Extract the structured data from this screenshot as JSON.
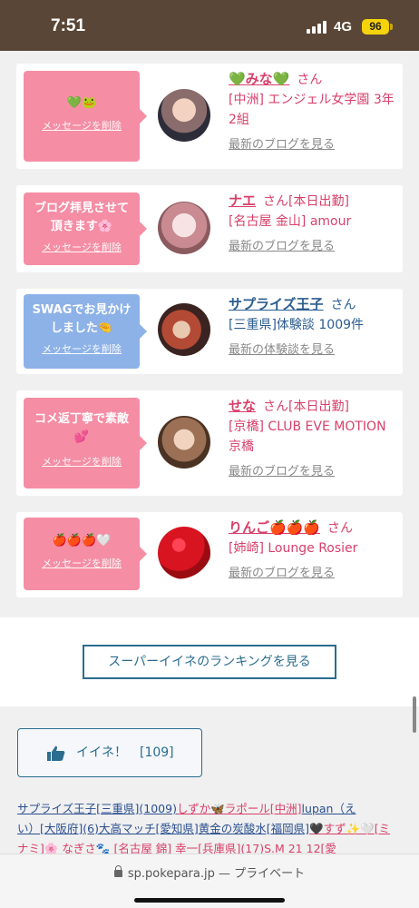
{
  "status_bar": {
    "time": "7:51",
    "network": "4G",
    "battery": "96"
  },
  "cards": [
    {
      "bubble_color": "pink",
      "bubble_text": "💚🐸",
      "delete_label": "メッセージを削除",
      "name": "💚みな💚",
      "san": "さん",
      "detail": "[中洲] エンジェル女学園 3年2組",
      "link": "最新のブログを見る"
    },
    {
      "bubble_color": "pink",
      "bubble_text": "ブログ拝見させて頂きます🌸",
      "delete_label": "メッセージを削除",
      "name": "ナエ",
      "san": "さん[本日出勤]",
      "detail": "[名古屋 金山] amour",
      "link": "最新のブログを見る"
    },
    {
      "bubble_color": "blue",
      "bubble_text": "SWAGでお見かけしました🤏",
      "delete_label": "メッセージを削除",
      "name": "サプライズ王子",
      "san": "さん",
      "detail": "[三重県]体験談 1009件",
      "link": "最新の体験談を見る"
    },
    {
      "bubble_color": "pink",
      "bubble_text": "コメ返丁寧で素敵💕",
      "delete_label": "メッセージを削除",
      "name": "せな",
      "san": "さん[本日出勤]",
      "detail": "[京橋] CLUB EVE MOTION 京橋",
      "link": "最新のブログを見る"
    },
    {
      "bubble_color": "pink",
      "bubble_text": "🍎🍎🍎🤍",
      "delete_label": "メッセージを削除",
      "name": "りんご🍎🍎🍎",
      "san": "さん",
      "detail": "[姉崎] Lounge Rosier",
      "link": "最新のブログを見る"
    }
  ],
  "ranking_button": "スーパーイイネのランキングを見る",
  "like_button": {
    "label": "イイネ！",
    "count": "[109]"
  },
  "like_list": {
    "line1_a": "サプライズ王子[三重県](1009)",
    "line1_b": "しずか🦋ラポール",
    "line1_c": "[中洲]",
    "line1_d": "lupan（え",
    "line2_a": "い）[大阪府](6)",
    "line2_b": "大高マッチ[愛知県]",
    "line2_c": "黄金の炭酸水[福岡県]",
    "line2_d": "🖤すず✨🤍",
    "line2_e": "[ミ",
    "line3": "ナミ]🌸 なぎさ🐾 [名古屋 錦] 幸一[兵庫県](17)S.M 21 12[愛"
  },
  "browser": {
    "url": "sp.pokepara.jp",
    "suffix": " — プライベート"
  }
}
